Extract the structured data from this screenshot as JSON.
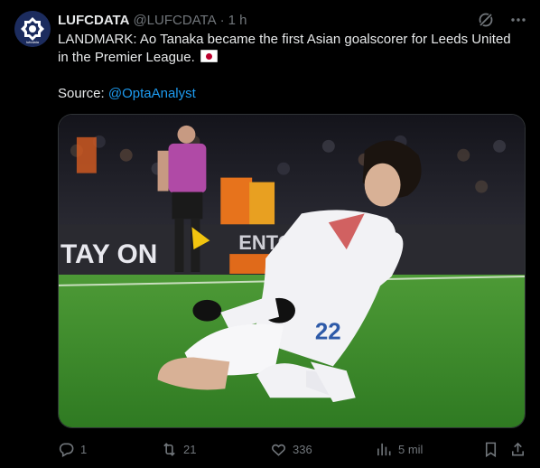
{
  "tweet": {
    "display_name": "LUFCDATA",
    "handle": "@LUFCDATA",
    "separator": "·",
    "time": "1 h",
    "text_line1": "LANDMARK: Ao Tanaka became the first Asian goalscorer for Leeds United in the Premier League.",
    "source_label": "Source: ",
    "source_link": "@OptaAnalyst",
    "avatar_text": "lufcdata",
    "image": {
      "board_text": "TAY ON",
      "board_text2": "ENTO",
      "shirt_number": "22"
    }
  },
  "actions": {
    "replies": "1",
    "reposts": "21",
    "likes": "336",
    "views": "5 mil"
  },
  "colors": {
    "background": "#000000",
    "text": "#e7e9ea",
    "muted": "#71767b",
    "link": "#1d9bf0",
    "pitch": "#3f8a2e"
  },
  "icons": [
    "grok-icon",
    "more-icon",
    "reply-icon",
    "repost-icon",
    "like-icon",
    "views-icon",
    "bookmark-icon",
    "share-icon"
  ]
}
